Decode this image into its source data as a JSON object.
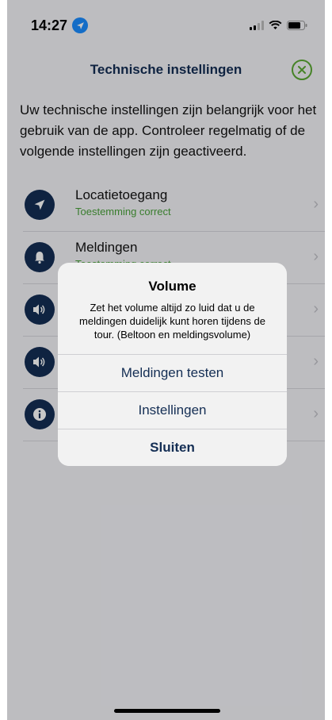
{
  "status_bar": {
    "time": "14:27"
  },
  "nav": {
    "title": "Technische instellingen"
  },
  "intro": "Uw technische instellingen zijn belangrijk voor het gebruik van de app. Controleer regelmatig of de volgende instellingen zijn geactiveerd.",
  "list": [
    {
      "title": "Locatietoegang",
      "subtitle": "Toestemming correct",
      "icon": "location-arrow-icon"
    },
    {
      "title": "Meldingen",
      "subtitle": "Toestemming correct",
      "icon": "bell-icon"
    },
    {
      "title": "",
      "subtitle": "",
      "icon": "speaker-icon"
    },
    {
      "title": "",
      "subtitle": "",
      "icon": "speaker-icon"
    },
    {
      "title": "",
      "subtitle": "",
      "icon": "info-icon"
    }
  ],
  "alert": {
    "title": "Volume",
    "message": "Zet het volume altijd zo luid dat u de meldingen duidelijk kunt horen tijdens de tour. (Beltoon en meldingsvolume)",
    "buttons": [
      "Meldingen testen",
      "Instellingen",
      "Sluiten"
    ]
  },
  "colors": {
    "navy": "#142e54",
    "green": "#4aa13a",
    "close_green": "#5aa832"
  }
}
